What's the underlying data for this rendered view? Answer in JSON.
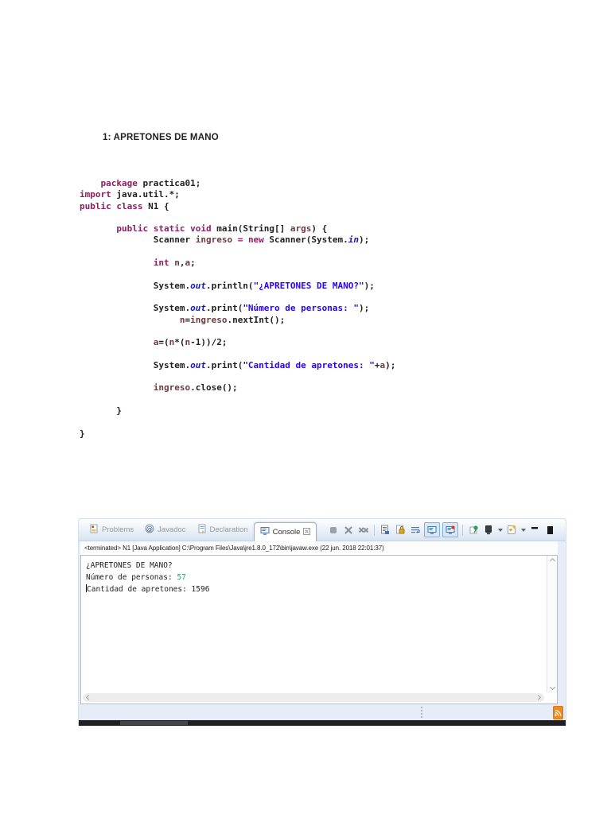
{
  "page": {
    "title": "1: APRETONES DE MANO"
  },
  "code": {
    "lines": [
      [
        {
          "t": "    "
        },
        {
          "t": "package",
          "c": "kw"
        },
        {
          "t": " practica01;"
        }
      ],
      [
        {
          "t": "import",
          "c": "kw"
        },
        {
          "t": " java.util.*;"
        }
      ],
      [
        {
          "t": "public class",
          "c": "kw"
        },
        {
          "t": " N1 {"
        }
      ],
      [],
      [
        {
          "t": "       "
        },
        {
          "t": "public static void",
          "c": "kw"
        },
        {
          "t": " main(String[] "
        },
        {
          "t": "args",
          "c": "var"
        },
        {
          "t": ") {"
        }
      ],
      [
        {
          "t": "              Scanner "
        },
        {
          "t": "ingreso",
          "c": "var"
        },
        {
          "t": " "
        },
        {
          "t": "=",
          "c": "kw"
        },
        {
          "t": " "
        },
        {
          "t": "new",
          "c": "kw"
        },
        {
          "t": " Scanner(System."
        },
        {
          "t": "in",
          "c": "sf"
        },
        {
          "t": ");"
        }
      ],
      [],
      [
        {
          "t": "              "
        },
        {
          "t": "int",
          "c": "kw"
        },
        {
          "t": " "
        },
        {
          "t": "n",
          "c": "var"
        },
        {
          "t": ","
        },
        {
          "t": "a",
          "c": "var"
        },
        {
          "t": ";"
        }
      ],
      [],
      [
        {
          "t": "              System."
        },
        {
          "t": "out",
          "c": "sf"
        },
        {
          "t": ".println("
        },
        {
          "t": "\"¿APRETONES DE MANO?\"",
          "c": "str"
        },
        {
          "t": ");"
        }
      ],
      [],
      [
        {
          "t": "              System."
        },
        {
          "t": "out",
          "c": "sf"
        },
        {
          "t": ".print("
        },
        {
          "t": "\"Número de personas: \"",
          "c": "str"
        },
        {
          "t": ");"
        }
      ],
      [
        {
          "t": "                   "
        },
        {
          "t": "n",
          "c": "var"
        },
        {
          "t": "="
        },
        {
          "t": "ingreso",
          "c": "var"
        },
        {
          "t": ".nextInt();"
        }
      ],
      [],
      [
        {
          "t": "              "
        },
        {
          "t": "a",
          "c": "var"
        },
        {
          "t": "=("
        },
        {
          "t": "n",
          "c": "var"
        },
        {
          "t": "*("
        },
        {
          "t": "n",
          "c": "var"
        },
        {
          "t": "-1))/2;"
        }
      ],
      [],
      [
        {
          "t": "              System."
        },
        {
          "t": "out",
          "c": "sf"
        },
        {
          "t": ".print("
        },
        {
          "t": "\"Cantidad de apretones: \"",
          "c": "str"
        },
        {
          "t": "+"
        },
        {
          "t": "a",
          "c": "var"
        },
        {
          "t": ");"
        }
      ],
      [],
      [
        {
          "t": "              "
        },
        {
          "t": "ingreso",
          "c": "var"
        },
        {
          "t": ".close();"
        }
      ],
      [],
      [
        {
          "t": "       }"
        }
      ],
      [],
      [
        {
          "t": "}"
        }
      ]
    ],
    "colors": {
      "keyword": "#8e1d62",
      "string": "#2a00ff",
      "static_field": "#1414c8",
      "local_var": "#6d3a3f",
      "plain": "#1f1f1f"
    }
  },
  "eclipse": {
    "tabs": [
      {
        "label": "Problems",
        "icon": "problems-icon",
        "active": false
      },
      {
        "label": "Javadoc",
        "icon": "javadoc-icon",
        "active": false
      },
      {
        "label": "Declaration",
        "icon": "declaration-icon",
        "active": false
      },
      {
        "label": "Console",
        "icon": "console-icon",
        "active": true
      }
    ],
    "toolbar_icons": [
      "terminate-icon",
      "remove-launch-icon",
      "remove-all-terminated-icon",
      "clear-console-icon",
      "scroll-lock-icon",
      "word-wrap-icon",
      "show-stdout-icon",
      "show-stderr-icon",
      "pin-console-icon",
      "display-console-icon",
      "open-console-icon",
      "minimize-icon",
      "maximize-icon"
    ],
    "status_line": "<terminated> N1 [Java Application] C:\\Program Files\\Java\\jre1.8.0_172\\bin\\javaw.exe (22 jun. 2018 22:01:37)",
    "console_lines": [
      [
        {
          "t": "¿APRETONES DE MANO?"
        }
      ],
      [
        {
          "t": "Número de personas: "
        },
        {
          "t": "57",
          "c": "grn"
        }
      ],
      [
        {
          "t": "",
          "c": "cursor"
        },
        {
          "t": "Cantidad de apretones: 1596"
        }
      ]
    ],
    "console_input_color": "#3aa169",
    "notification_icon": "feed-icon"
  }
}
